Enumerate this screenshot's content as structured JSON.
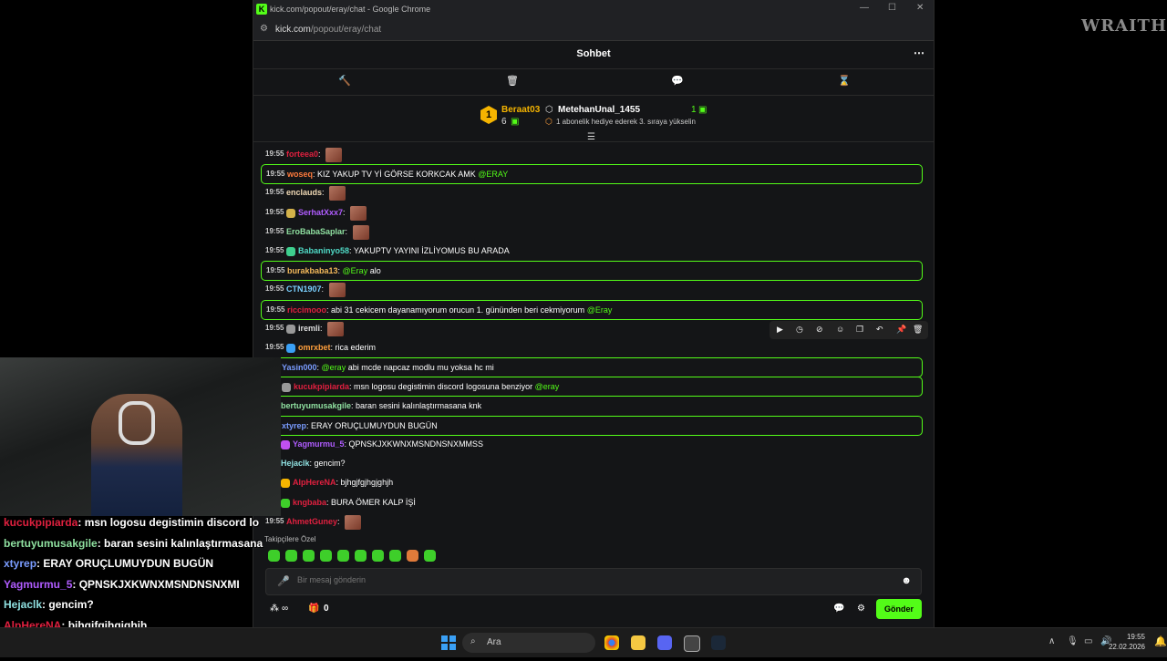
{
  "browser": {
    "title": "kick.com/popout/eray/chat - Google Chrome",
    "url_domain": "kick.com",
    "url_path": "/popout/eray/chat"
  },
  "chat": {
    "title": "Sohbet",
    "menu_icon": "more-icon"
  },
  "pinned": {
    "rank": "1",
    "user1": {
      "name": "Beraat03",
      "count": "6"
    },
    "user2": {
      "name": "MetehanUnal_1455",
      "count": "1",
      "note": "1 abonelik hediye ederek 3. sıraya yükselin"
    }
  },
  "messages": [
    {
      "time": "19:55",
      "user": "forteea0",
      "color": "#e0203f",
      "text": "",
      "emote": true,
      "hl": false
    },
    {
      "time": "19:55",
      "user": "woseq",
      "color": "#ff7a3c",
      "text": "KIZ YAKUP TV Yİ GÖRSE KORKCAK AMK ",
      "mention": "@ERAY",
      "hl": true
    },
    {
      "time": "19:55",
      "user": "enclauds",
      "color": "#f0d9b5",
      "text": "",
      "emote": true,
      "hl": false
    },
    {
      "time": "19:55",
      "user": "SerhatXxx7",
      "color": "#b05cff",
      "text": "",
      "emote": true,
      "hl": false,
      "badge": "#d4b24a"
    },
    {
      "time": "19:55",
      "user": "EroBabaSaplar",
      "color": "#8fe0a0",
      "text": "",
      "emote": true,
      "hl": false
    },
    {
      "time": "19:55",
      "user": "Babaninyo58",
      "color": "#4fd9c5",
      "text": "YAKUPTV YAYINI İZLİYOMUS BU ARADA",
      "hl": false,
      "badge": "#3ecf8e"
    },
    {
      "time": "19:55",
      "user": "burakbaba13",
      "color": "#f3b85a",
      "text": "alo",
      "mention_before": "@Eray",
      "hl": true
    },
    {
      "time": "19:55",
      "user": "CTN1907",
      "color": "#7ad0ff",
      "text": "",
      "emote": true,
      "hl": false
    },
    {
      "time": "19:55",
      "user": "riccimooo",
      "color": "#e0203f",
      "text": "abi 31 cekicem dayanamıyorum orucun 1. gününden beri cekmiyorum ",
      "mention": "@Eray",
      "hl": true
    },
    {
      "time": "19:55",
      "user": "iremli",
      "color": "#dddddd",
      "text": "",
      "emote": true,
      "hl": false,
      "badge": "#999999"
    },
    {
      "time": "19:55",
      "user": "omrxbet",
      "color": "#ff9f3c",
      "text": "rica ederim",
      "hl": false,
      "badge": "#3aa0f5"
    },
    {
      "time": "",
      "user": "Yasin000",
      "color": "#7a9cff",
      "text": "abi mcde napcaz modlu mu yoksa hc mi",
      "mention_before": "@eray",
      "hl": true
    },
    {
      "time": "",
      "user": "kucukpipiarda",
      "color": "#e0203f",
      "text": "msn logosu degistimin discord logosuna benziyor ",
      "mention": "@eray",
      "hl": true,
      "badge": "#999999"
    },
    {
      "time": "",
      "user": "bertuyumusakgile",
      "color": "#8fe0a0",
      "text": "baran sesini kalınlaştırmasana knk",
      "hl": false
    },
    {
      "time": "",
      "user": "xtyrep",
      "color": "#7a9cff",
      "text": "ERAY ORUÇLUMUYDUN BUGÜN",
      "hl": true
    },
    {
      "time": "",
      "user": "Yagmurmu_5",
      "color": "#b05cff",
      "text": "QPNSKJXKWNXMSNDNSNXMMSS",
      "hl": false,
      "badge": "#c050f0"
    },
    {
      "time": "",
      "user": "Hejaclk",
      "color": "#8fe0e0",
      "text": "gencim?",
      "hl": false
    },
    {
      "time": "",
      "user": "AlpHereNA",
      "color": "#e0203f",
      "text": "bjhgjfgjhgjghjh",
      "hl": false,
      "badge": "#f5b400"
    },
    {
      "time": "",
      "user": "kngbaba",
      "color": "#e0203f",
      "text": "BURA ÖMER KALP İŞİ",
      "hl": false,
      "badge": "#3ecf2a"
    },
    {
      "time": "19:55",
      "user": "AhmetGuney",
      "color": "#e0203f",
      "text": "",
      "emote": true,
      "hl": false
    }
  ],
  "emote_label": "Takipçilere Özel",
  "input": {
    "placeholder": "Bir mesaj gönderin"
  },
  "footer": {
    "infinity": "∞",
    "gift_count": "0",
    "send": "Gönder"
  },
  "overlay": [
    {
      "user": "kucukpipiarda",
      "color": "#e0203f",
      "text": ": msn logosu degistimin discord lo"
    },
    {
      "user": "bertuyumusakgile",
      "color": "#8fe0a0",
      "text": ": baran sesini kalınlaştırmasana"
    },
    {
      "user": "xtyrep",
      "color": "#7a9cff",
      "text": ": ERAY ORUÇLUMUYDUN BUGÜN"
    },
    {
      "user": "Yagmurmu_5",
      "color": "#b05cff",
      "text": ": QPNSKJXKWNXMSNDNSNXMI"
    },
    {
      "user": "Hejaclk",
      "color": "#8fe0e0",
      "text": ": gencim?"
    },
    {
      "user": "AlpHereNA",
      "color": "#e0203f",
      "text": ": bjhgjfgjhgjghjh"
    },
    {
      "user": "kngbaba",
      "color": "#e0203f",
      "text": ": BURA ÖMER KALP İŞİ"
    }
  ],
  "watermark": "WRAITH",
  "taskbar": {
    "search": "Ara",
    "time": "19:55",
    "date": "22.02.2026"
  }
}
